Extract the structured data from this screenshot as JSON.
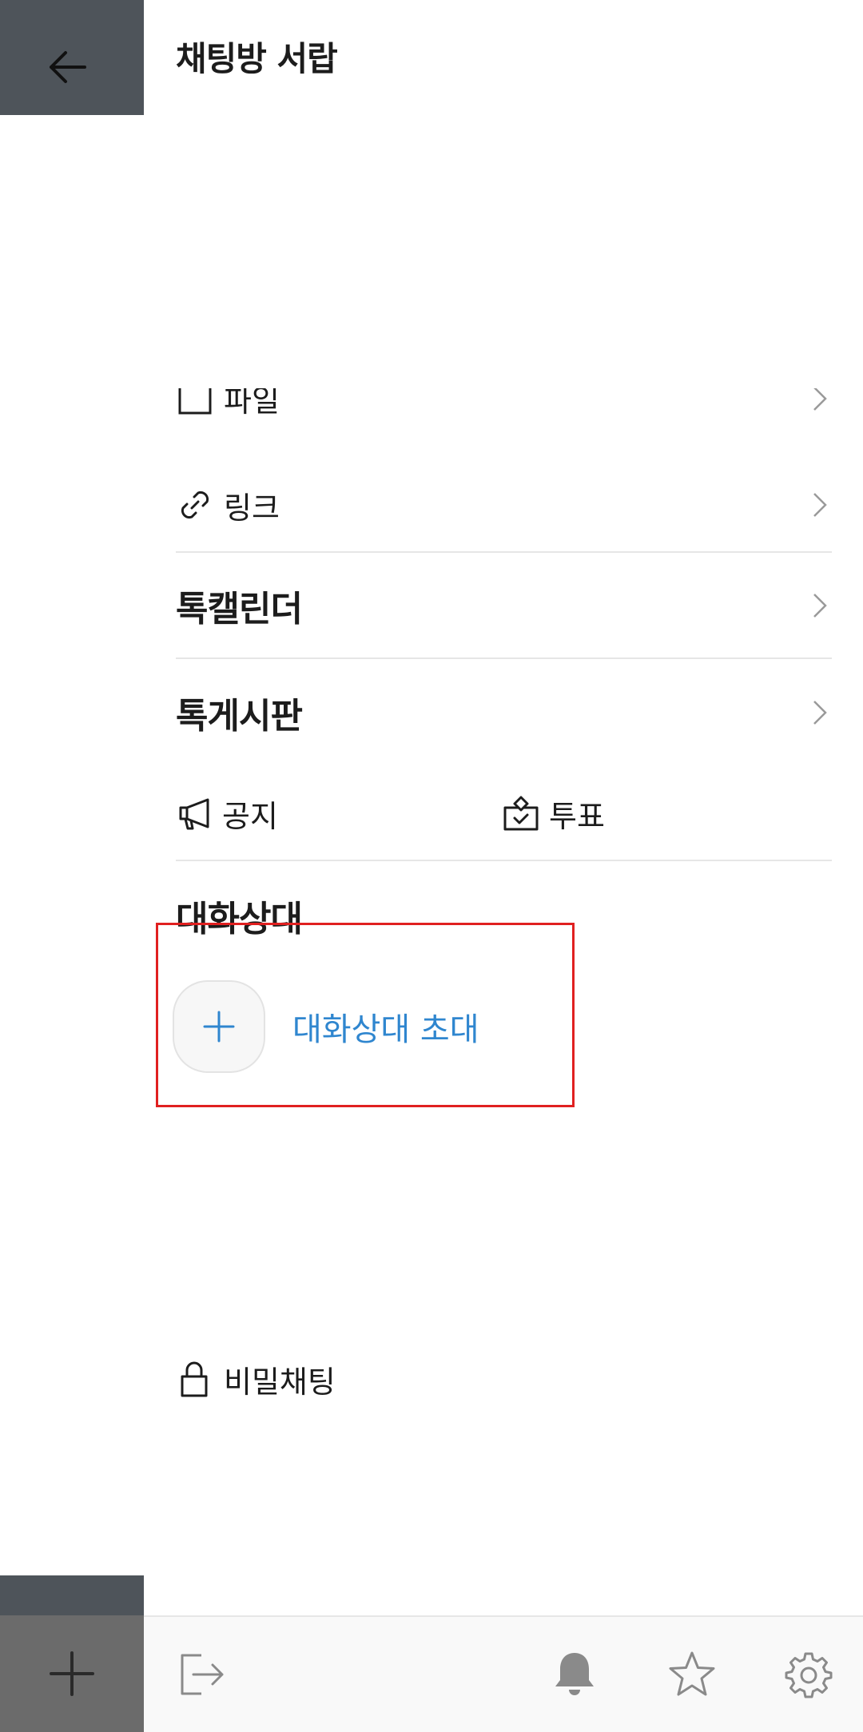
{
  "drawer": {
    "title": "채팅방 서랍",
    "items": {
      "file_label": "파일",
      "link_label": "링크",
      "calendar_label": "톡캘린더",
      "board_label": "톡게시판",
      "notice_label": "공지",
      "vote_label": "투표"
    },
    "members": {
      "heading": "대화상대",
      "invite_label": "대화상대 초대"
    },
    "secret_chat_label": "비밀채팅"
  },
  "icons": {
    "back": "arrow-left-icon",
    "file": "folder-icon",
    "link": "link-icon",
    "chevron": "chevron-right-icon",
    "notice": "megaphone-icon",
    "vote": "ballot-box-icon",
    "invite": "plus-icon",
    "secret": "lock-icon",
    "exit": "exit-icon",
    "notification": "bell-icon",
    "favorite": "star-icon",
    "settings": "gear-icon",
    "compose": "plus-icon"
  },
  "colors": {
    "accent_blue": "#2f86cf",
    "highlight_red": "#e02020",
    "overlay_dark": "#4e545a"
  }
}
